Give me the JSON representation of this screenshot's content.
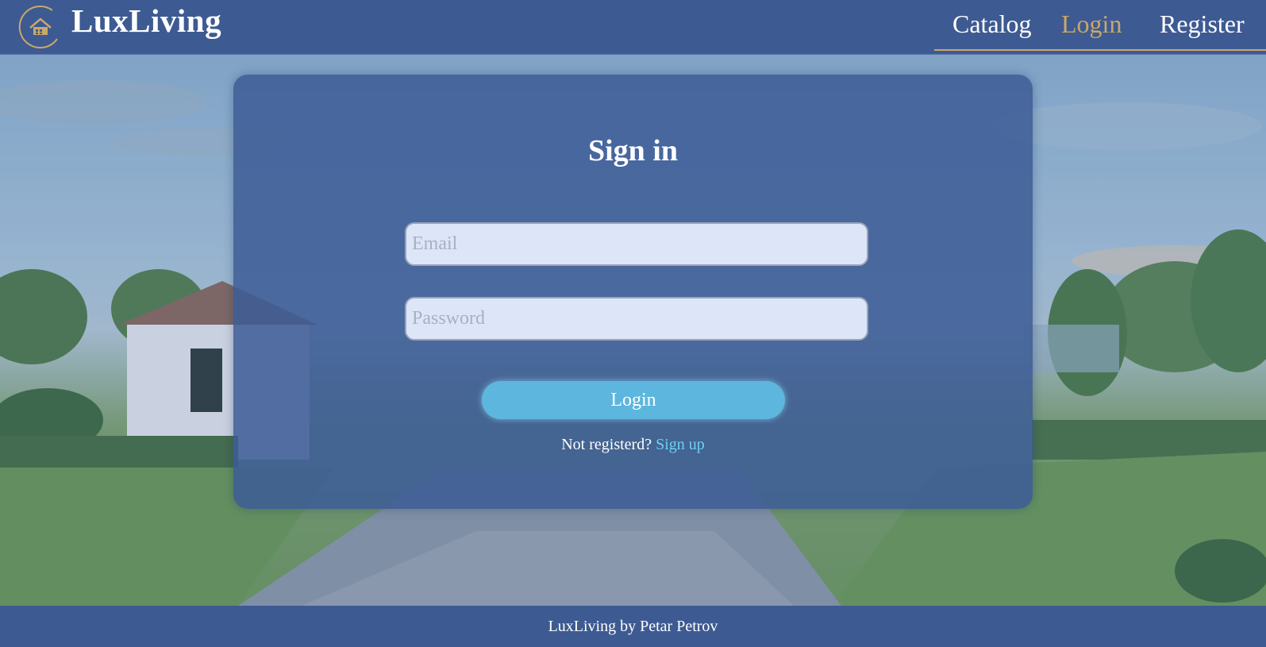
{
  "header": {
    "brand": "LuxLiving",
    "logo_icon": "house-icon",
    "nav": [
      {
        "label": "Catalog",
        "active": false
      },
      {
        "label": "Login",
        "active": true
      },
      {
        "label": "Register",
        "active": false
      }
    ]
  },
  "form": {
    "title": "Sign in",
    "email_placeholder": "Email",
    "email_value": "",
    "password_placeholder": "Password",
    "password_value": "",
    "submit_label": "Login",
    "signup_prompt": "Not registerd?",
    "signup_link": "Sign up"
  },
  "footer": {
    "text": "LuxLiving by Petar Petrov"
  },
  "colors": {
    "header_bg": "#3d5a92",
    "accent_gold": "#c9a86a",
    "button_bg": "#5db6dd",
    "link": "#6fd0f5"
  }
}
